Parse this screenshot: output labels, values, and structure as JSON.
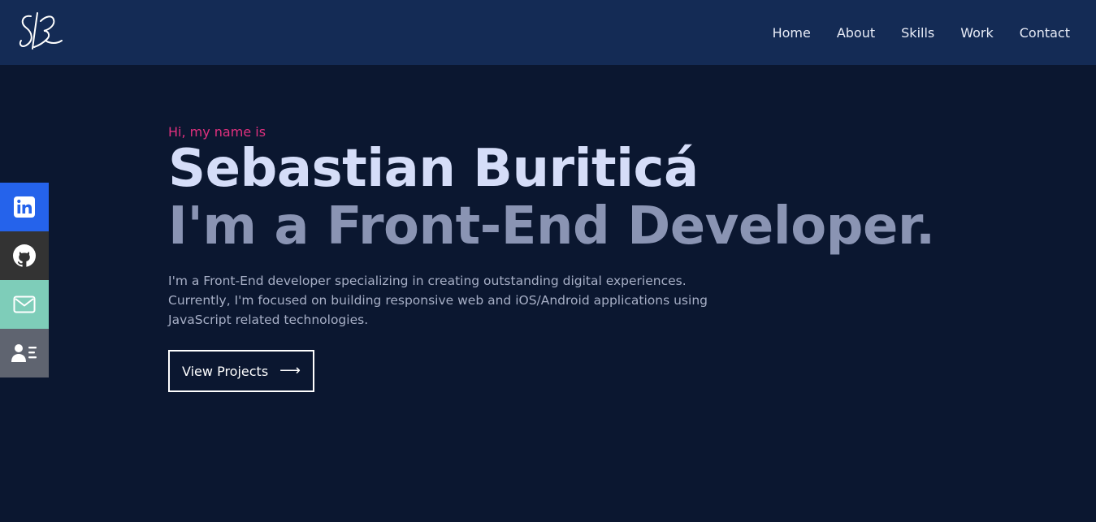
{
  "brand": {
    "logo_text": "SB"
  },
  "nav": {
    "items": [
      {
        "label": "Home"
      },
      {
        "label": "About"
      },
      {
        "label": "Skills"
      },
      {
        "label": "Work"
      },
      {
        "label": "Contact"
      }
    ]
  },
  "social": {
    "items": [
      {
        "icon": "linkedin-icon"
      },
      {
        "icon": "github-icon"
      },
      {
        "icon": "mail-icon"
      },
      {
        "icon": "resume-icon"
      }
    ]
  },
  "hero": {
    "greeting": "Hi, my name is",
    "name": "Sebastian Buriticá",
    "role": "I'm a Front-End Developer.",
    "intro": "I'm a Front-End developer specializing in creating outstanding digital experiences. Currently, I'm focused on building responsive web and iOS/Android applications using JavaScript related technologies.",
    "cta_label": "View Projects",
    "cta_icon": "arrow-right-icon"
  },
  "colors": {
    "background": "#0b1730",
    "topbar": "#142b55",
    "accent_pink": "#e0307e",
    "linkedin": "#2563eb",
    "github": "#333333",
    "mail": "#7ecdb9",
    "resume": "#5f6470"
  }
}
